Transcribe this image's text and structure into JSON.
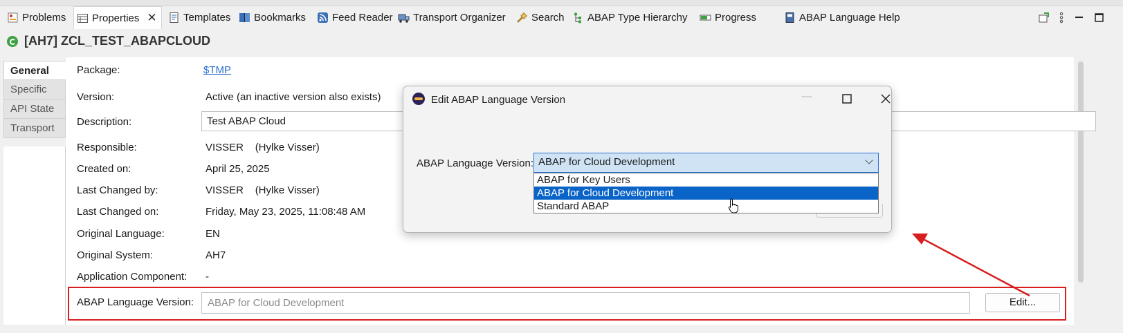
{
  "tabs": [
    {
      "label": "Problems",
      "icon": "problems-icon"
    },
    {
      "label": "Properties",
      "icon": "properties-icon",
      "active": true
    },
    {
      "label": "Templates",
      "icon": "templates-icon"
    },
    {
      "label": "Bookmarks",
      "icon": "bookmarks-icon"
    },
    {
      "label": "Feed Reader",
      "icon": "feed-icon"
    },
    {
      "label": "Transport Organizer",
      "icon": "transport-icon"
    },
    {
      "label": "Search",
      "icon": "search-icon"
    },
    {
      "label": "ABAP Type Hierarchy",
      "icon": "hierarchy-icon"
    },
    {
      "label": "Progress",
      "icon": "progress-icon"
    },
    {
      "label": "ABAP Language Help",
      "icon": "help-book-icon"
    }
  ],
  "object_title": "[AH7] ZCL_TEST_ABAPCLOUD",
  "side_tabs": [
    "General",
    "Specific",
    "API State",
    "Transport"
  ],
  "properties": {
    "package_label": "Package:",
    "package_value": "$TMP",
    "version_label": "Version:",
    "version_value": "Active (an inactive version also exists)",
    "description_label": "Description:",
    "description_value": "Test ABAP Cloud",
    "responsible_label": "Responsible:",
    "responsible_value": "VISSER    (Hylke Visser)",
    "created_on_label": "Created on:",
    "created_on_value": "April 25, 2025",
    "last_changed_by_label": "Last Changed by:",
    "last_changed_by_value": "VISSER    (Hylke Visser)",
    "last_changed_on_label": "Last Changed on:",
    "last_changed_on_value": "Friday, May 23, 2025, 11:08:48 AM",
    "orig_lang_label": "Original Language:",
    "orig_lang_value": "EN",
    "orig_system_label": "Original System:",
    "orig_system_value": "AH7",
    "app_component_label": "Application Component:",
    "app_component_value": "-",
    "alv_label": "ABAP Language Version:",
    "alv_value": "ABAP for Cloud Development",
    "edit_button": "Edit..."
  },
  "dialog": {
    "title": "Edit ABAP Language Version",
    "field_label": "ABAP Language Version:",
    "selected_value": "ABAP for Cloud Development",
    "options": [
      "ABAP for Key Users",
      "ABAP for Cloud Development",
      "Standard ABAP"
    ],
    "highlighted_option_index": 1
  },
  "colors": {
    "annotation_red": "#d81e1e",
    "selection_blue": "#0a64c8",
    "link_blue": "#2a6fd1"
  }
}
